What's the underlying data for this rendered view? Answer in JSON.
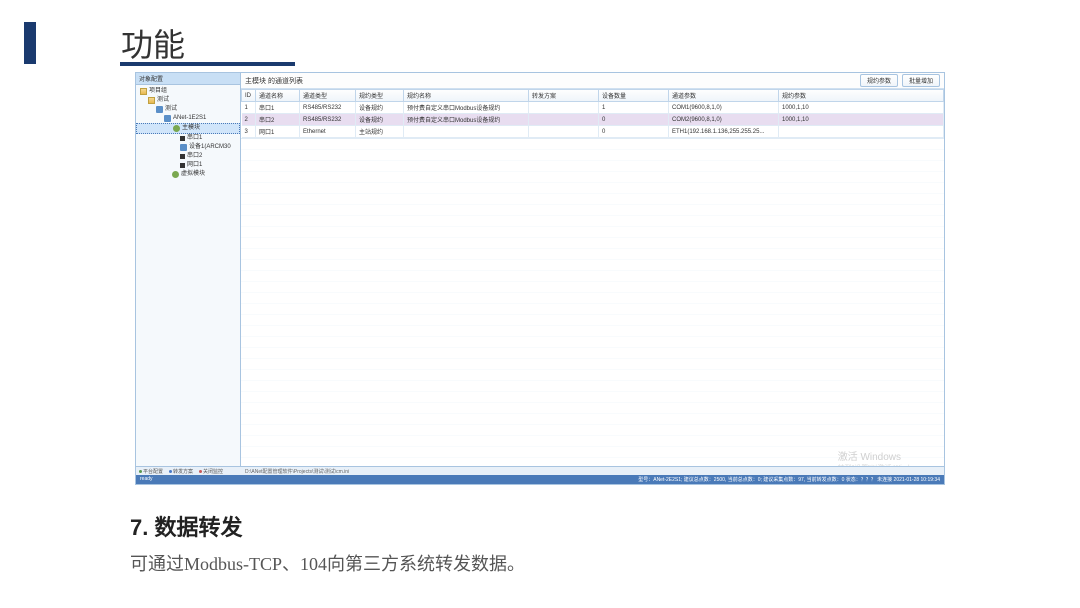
{
  "slide": {
    "title": "功能"
  },
  "tree": {
    "header": "对象配置",
    "items": [
      {
        "label": "项目组",
        "level": 1,
        "icon": "folder"
      },
      {
        "label": "测试",
        "level": 2,
        "icon": "folder"
      },
      {
        "label": "测试",
        "level": 3,
        "icon": "device"
      },
      {
        "label": "ANet-1E2S1",
        "level": 4,
        "icon": "device"
      },
      {
        "label": "主模块",
        "level": 5,
        "icon": "node",
        "selected": true
      },
      {
        "label": "串口1",
        "level": 6,
        "icon": "port"
      },
      {
        "label": "设备1(ARCM30",
        "level": 6,
        "icon": "device"
      },
      {
        "label": "串口2",
        "level": 6,
        "icon": "port"
      },
      {
        "label": "网口1",
        "level": 6,
        "icon": "port"
      },
      {
        "label": "虚拟模块",
        "level": 5,
        "icon": "node"
      }
    ]
  },
  "panel": {
    "title": "主模块 的通道列表",
    "btn1": "规约参数",
    "btn2": "批量增加"
  },
  "table": {
    "headers": [
      "ID",
      "通道名称",
      "通道类型",
      "规约类型",
      "规约名称",
      "转发方案",
      "设备数量",
      "通道参数",
      "规约参数"
    ],
    "rows": [
      [
        "1",
        "串口1",
        "RS485/RS232",
        "设备规约",
        "预付费自定义串口Modbus设备规约",
        "",
        "1",
        "COM1(9600,8,1,0)",
        "1000,1,10"
      ],
      [
        "2",
        "串口2",
        "RS485/RS232",
        "设备规约",
        "预付费自定义串口Modbus设备规约",
        "",
        "0",
        "COM2(9600,8,1,0)",
        "1000,1,10"
      ],
      [
        "3",
        "网口1",
        "Ethernet",
        "主站规约",
        "",
        "",
        "0",
        "ETH1(192.168.1.136,255.255.25...",
        ""
      ]
    ]
  },
  "tabs": {
    "t1": "平台配置",
    "t2": "转发方案",
    "t3": "关闭监控"
  },
  "pathbar": "D:\\ANet配置管理软件\\Projects\\测试\\测试\\cm.ini",
  "statusbar": {
    "left": "ready",
    "right": "型号：ANet-2E2S1; 建议总点数：2500, 当前总点数：0; 建议采集点数：97, 当前转发点数：0   状态：？？？   未连接   2021-01-28 10:19:34"
  },
  "watermark": {
    "line1": "激活 Windows",
    "line2": "转到\"设置\"以激活 Windows。"
  },
  "section": {
    "heading": "7. 数据转发",
    "body": "可通过Modbus-TCP、104向第三方系统转发数据。"
  }
}
